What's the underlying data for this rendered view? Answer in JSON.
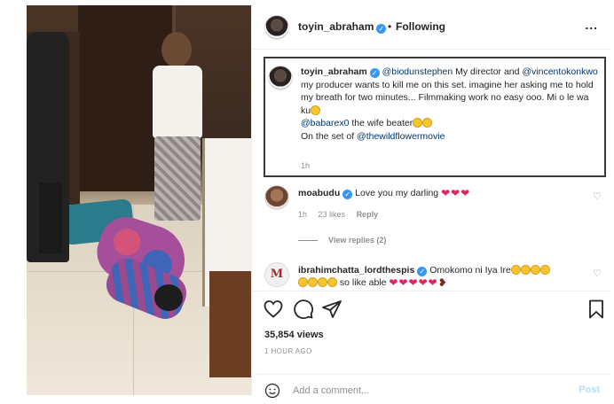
{
  "post": {
    "author": "toyin_abraham",
    "follow_status": "Following",
    "more": "...",
    "caption": {
      "user": "toyin_abraham",
      "mention1": "@biodunstephen",
      "text1": " My director and ",
      "mention2": "@vincentokonkwo",
      "text2": " my producer wants to kill me on this set. imagine her asking me to hold my breath for two minutes... Filmmaking work no easy ooo. Mi o le wa ku",
      "mention3": "@babarex0",
      "text3": " the wife beater",
      "text4": "On the set of ",
      "mention4": "@thewildflowermovie",
      "time": "1h"
    }
  },
  "comments": [
    {
      "user": "moabudu",
      "text": "Love you my darling",
      "time": "1h",
      "likes": "23 likes",
      "reply": "Reply",
      "view_replies": "View replies (2)"
    },
    {
      "user": "ibrahimchatta_lordthespis",
      "text1": "Omokomo ni Iya Ire",
      "text2": "so like able",
      "avatar_letter": "M"
    }
  ],
  "footer": {
    "views": "35,854 views",
    "ago": "1 HOUR AGO",
    "comment_placeholder": "Add a comment...",
    "post_label": "Post"
  },
  "colors": {
    "verified": "#3897f0",
    "heart": "#e0245e",
    "mention": "#00376b"
  }
}
